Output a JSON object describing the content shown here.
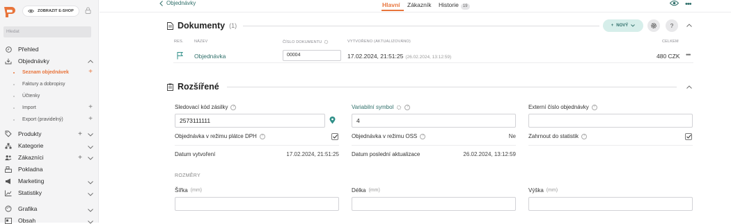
{
  "colors": {
    "accent": "#e8743b",
    "teal": "#2f6f6a",
    "sidebar_bg": "#f4f4f5"
  },
  "sidebar": {
    "eshop_button": "ZOBRAZIT E-SHOP",
    "search_placeholder": "Hledat",
    "items": [
      {
        "label": "Přehled",
        "icon": "info-icon"
      },
      {
        "label": "Objednávky",
        "icon": "download-tray-icon"
      },
      {
        "label": "Produkty",
        "icon": "tag-icon"
      },
      {
        "label": "Kategorie",
        "icon": "sitemap-icon"
      },
      {
        "label": "Zákazníci",
        "icon": "users-icon"
      },
      {
        "label": "Pokladna",
        "icon": "cash-register-icon"
      },
      {
        "label": "Marketing",
        "icon": "megaphone-icon"
      },
      {
        "label": "Statistiky",
        "icon": "chart-icon"
      },
      {
        "label": "Grafika",
        "icon": "palette-icon"
      },
      {
        "label": "Obsah",
        "icon": "content-icon"
      }
    ],
    "sub_items": [
      {
        "label": "Seznam objednávek",
        "active": true
      },
      {
        "label": "Faktury a dobropisy"
      },
      {
        "label": "Účtenky"
      },
      {
        "label": "Import"
      },
      {
        "label": "Export (pravidelný)"
      }
    ]
  },
  "topbar": {
    "back_label": "Objednávky",
    "tabs": [
      {
        "label": "Hlavní",
        "active": true
      },
      {
        "label": "Zákazník"
      },
      {
        "label": "Historie",
        "badge": "19"
      }
    ]
  },
  "documents": {
    "title": "Dokumenty",
    "count": "(1)",
    "new_button": "NOVÝ",
    "help_label": "?",
    "columns": {
      "res": "RES.",
      "name": "NÁZEV",
      "number": "ČÍSLO DOKUMENTU",
      "created": "VYTVOŘENO (AKTUALIZOVÁNO)",
      "total": "CELKEM"
    },
    "rows": [
      {
        "name": "Objednávka",
        "number": "00004",
        "created": "17.02.2024, 21:51:25",
        "updated": "(26.02.2024, 13:12:59)",
        "total": "480 CZK"
      }
    ]
  },
  "extended": {
    "title": "Rozšířené",
    "tracking_label": "Sledovací kód zásilky",
    "tracking_value": "2573111111",
    "variable_symbol_label": "Variabilní symbol",
    "variable_symbol_value": "4",
    "external_number_label": "Externí číslo objednávky",
    "external_number_value": "",
    "vat_payer_label": "Objednávka v režimu plátce DPH",
    "vat_payer_checked": true,
    "oss_label": "Objednávka v režimu OSS",
    "oss_value": "Ne",
    "stats_label": "Zahrnout do statistik",
    "stats_checked": true,
    "created_label": "Datum vytvoření",
    "created_value": "17.02.2024, 21:51:25",
    "updated_label": "Datum poslední aktualizace",
    "updated_value": "26.02.2024, 13:12:59",
    "dimensions_label": "ROZMĚRY",
    "width_label": "Šířka",
    "length_label": "Délka",
    "height_label": "Výška",
    "unit": "(mm)"
  }
}
